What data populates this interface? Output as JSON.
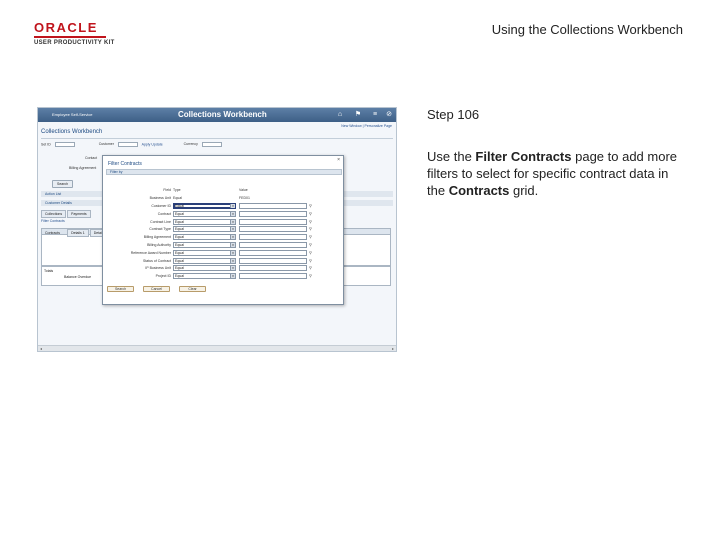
{
  "header": {
    "logo_oracle": "ORACLE",
    "logo_upk": "USER PRODUCTIVITY KIT",
    "title": "Using the Collections Workbench"
  },
  "step": {
    "label": "Step 106",
    "desc_parts": [
      "Use the ",
      "Filter Contracts",
      " page to add more filters to select for specific contract data in the ",
      "Contracts",
      " grid."
    ]
  },
  "screenshot": {
    "home_label": "Employee Self-Service",
    "app_title": "Collections Workbench",
    "links": "New Window | Personalize Page",
    "page_heading": "Collections Workbench",
    "row1_label": "Set ID",
    "row1_value": "FED",
    "row1b_label": "Customer",
    "row1c_label": "Apply Update",
    "row1d_label": "Currency",
    "row2_label": "Contact",
    "row3_label": "Billing Agreement",
    "search_btn": "Search",
    "section1": "Action List",
    "section2": "Customer Details",
    "tabs": [
      "Collections",
      "Payments"
    ],
    "filter_link": "Filter Contracts",
    "grid_label": "Contracts",
    "grid_tabs": [
      "Details 1",
      "Details 2"
    ],
    "totals_label": "Totals",
    "totals_sub": "Balance Overdue",
    "modal": {
      "title": "Filter Contracts",
      "band": "Filter by",
      "rows": [
        {
          "label": "Field",
          "c1": "Type",
          "c2": "Value"
        },
        {
          "label": "Business Unit",
          "c1": "Equal",
          "c2": "FED01"
        },
        {
          "label": "Customer ID",
          "sel": "Equal",
          "val": "",
          "active": true
        },
        {
          "label": "Contract",
          "sel": "Equal",
          "val": ""
        },
        {
          "label": "Contract Line",
          "sel": "Equal",
          "val": ""
        },
        {
          "label": "Contract Type",
          "sel": "Equal",
          "val": ""
        },
        {
          "label": "Billing Agreement",
          "sel": "Equal",
          "val": ""
        },
        {
          "label": "Billing Authority",
          "sel": "Equal",
          "val": ""
        },
        {
          "label": "Reference Award Number",
          "sel": "Equal",
          "val": ""
        },
        {
          "label": "Status of Contract",
          "sel": "Equal",
          "val": ""
        },
        {
          "label": "IP Business Unit",
          "sel": "Equal",
          "val": ""
        },
        {
          "label": "Project ID",
          "sel": "Equal",
          "val": ""
        }
      ],
      "buttons": [
        "Search",
        "Cancel",
        "Clear"
      ]
    }
  }
}
